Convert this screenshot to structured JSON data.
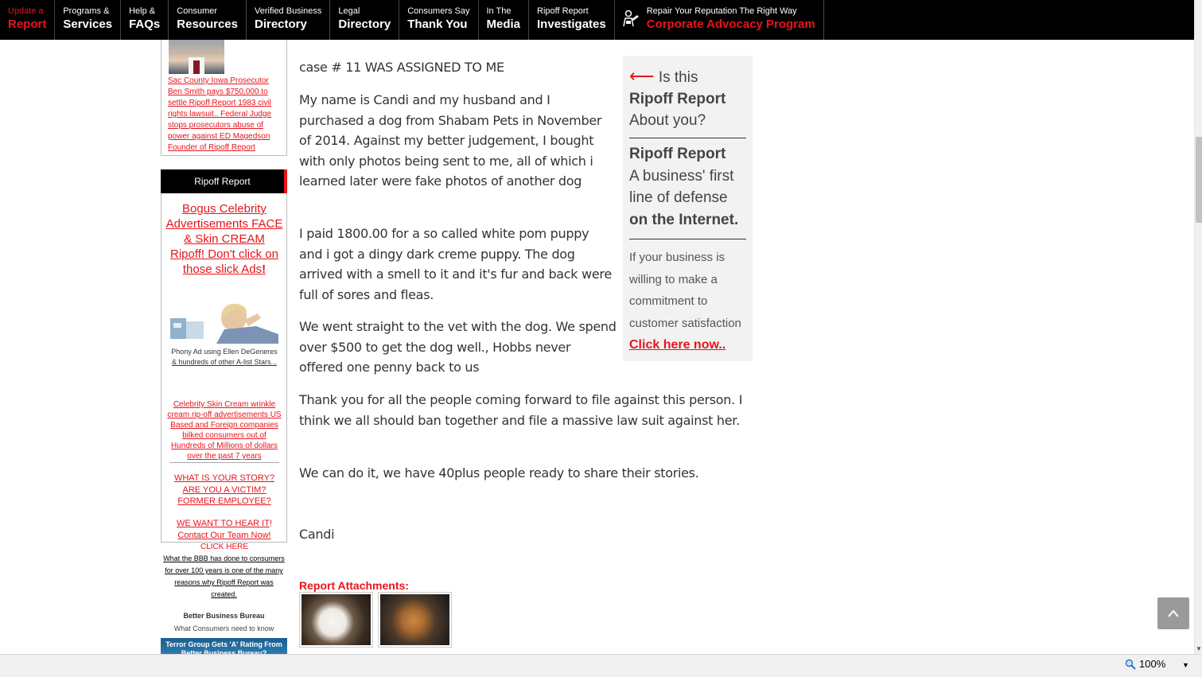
{
  "nav": [
    {
      "small": "Update a",
      "big": "Report"
    },
    {
      "small": "Programs &",
      "big": "Services"
    },
    {
      "small": "Help &",
      "big": "FAQs"
    },
    {
      "small": "Consumer",
      "big": "Resources"
    },
    {
      "small": "Verified Business",
      "big": "Directory"
    },
    {
      "small": "Legal",
      "big": "Directory"
    },
    {
      "small": "Consumers Say",
      "big": "Thank You"
    },
    {
      "small": "In The",
      "big": "Media"
    },
    {
      "small": "Ripoff Report",
      "big": "Investigates"
    },
    {
      "small": "Repair Your Reputation The Right Way",
      "big": "Corporate Advocacy Program"
    }
  ],
  "sidebar": {
    "prosecutor_link": "Sac  County Iowa Prosecutor Ben Smith pays $750,000 to settle Ripoff Report 1983 civil rights lawsuit.. Federal Judge stops prosecutors abuse of power against ED Magedson Founder of Ripoff Report",
    "rr_header": "Ripoff Report",
    "bogus_link": "Bogus Celebrity Advertisements FACE & Skin CREAM Ripoff! Don't click on those slick Ads",
    "bogus_bang": "!",
    "phony_caption_1": "Phony Ad using Ellen DeGeneres",
    "phony_caption_2": "& hundreds of other A-list Stars...",
    "skin_link": "Celebrity Skin Cream wrinkle cream rip-off advertisements US Based and Foreign companies bilked consumers out of Hundreds of Millions of dollars over the past 7 years",
    "story_link": "WHAT IS YOUR STORY? ARE YOU A VICTIM? FORMER EMPLOYEE?",
    "hear_link": "WE WANT TO HEAR IT",
    "hear_bang": "!",
    "contact_link": "Contact Our Team Now!",
    "click_here": "CLICK HERE",
    "bbb_text": "What the BBB has done to consumers for over 100 years is one of the many reasons why Ripoff Report was created.",
    "bbb_title": "Better Business Bureau",
    "bbb_sub": "What Consumers need to know",
    "terror_banner": "Terror Group Gets 'A' Rating From Better Business Bureau?"
  },
  "report": {
    "case_line": "case # 11 WAS ASSIGNED TO ME",
    "p1": "My name is Candi and my husband and I purchased a dog from Shabam Pets in November of 2014. Against my better judgement, I bought with only photos being sent to me, all of which i learned later were fake photos of another dog",
    "p2": "I paid 1800.00 for a so called white pom puppy and i got a dingy dark creme puppy. The dog arrived with a smell to it and it's fur and back were full of sores and fleas.",
    "p3": "We went straight to the vet with the dog. We spend over $500 to get the dog well., Hobbs never offered one penny back to us",
    "p4": "Thank you for all the people coming forward to file against this person. I think we all should ban together and file a massive law suit against her.",
    "p5": "We can do it, we have 40plus people ready to share their stories.",
    "signature": "Candi",
    "attachments_label": "Report Attachments:"
  },
  "ad": {
    "arrow": "⟵",
    "is_this": " Is this",
    "brand": "Ripoff Report",
    "about_you": "About you?",
    "brand2": "Ripoff Report",
    "defense_1": "A business' first line of defense",
    "defense_2": "on the Internet.",
    "willing": "If your business is willing to make a commitment to customer satisfaction",
    "click": "Click here now.."
  },
  "status": {
    "zoom": "100%"
  },
  "colors": {
    "accent_red": "#e8141b",
    "nav_bg": "#000000"
  }
}
